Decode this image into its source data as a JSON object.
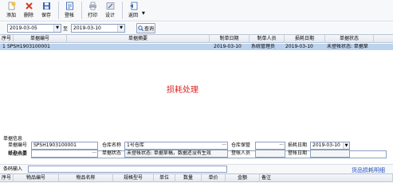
{
  "toolbar": {
    "buttons": [
      {
        "label": "添加",
        "icon": "add-doc-icon",
        "color": "#f2c53d"
      },
      {
        "label": "删除",
        "icon": "delete-x-icon",
        "color": "#d23c2c"
      },
      {
        "label": "保存",
        "icon": "save-disk-icon",
        "color": "#3b66b5"
      },
      {
        "label": "登帐",
        "icon": "post-account-icon",
        "color": "#3b66b5"
      },
      {
        "label": "打印",
        "icon": "printer-icon",
        "color": "#7a8494"
      },
      {
        "label": "设计",
        "icon": "design-icon",
        "color": "#7a8494"
      },
      {
        "label": "返回",
        "icon": "return-icon",
        "color": "#3b66b5"
      }
    ]
  },
  "filter": {
    "date_from": "2019-03-05",
    "to_label": "至",
    "date_to": "2019-03-10",
    "query_label": "查询"
  },
  "grid": {
    "columns": [
      "序号",
      "单据编号",
      "单据摘要",
      "制单日期",
      "制单人员",
      "损耗日期",
      "单据状态"
    ],
    "rows": [
      {
        "no": "1",
        "code": "SPSH1903100001",
        "summary": "",
        "make_date": "2019-03-10",
        "maker": "系统管理员",
        "loss_date": "2019-03-10",
        "status": "未登帐状态: 单据草"
      }
    ],
    "watermark": "损耗处理"
  },
  "detail": {
    "title": "单据信息",
    "doc_code_label": "单据编号",
    "doc_code": "SPSH1903100001",
    "warehouse_label": "仓库名称",
    "warehouse": "1号仓库",
    "keeper_label": "仓库保管",
    "keeper": "",
    "loss_date_label": "损耗日期",
    "loss_date": "2019-03-10",
    "summary_label": "单据摘要",
    "summary": "",
    "handler_label": "经办人员",
    "handler": "",
    "status_label": "单据状态",
    "status": "未登帐状态: 单据草稿，数据还没有生效",
    "post_person_label": "登帐人员",
    "post_person": "",
    "post_date_label": "登帐日期",
    "post_date": ""
  },
  "barcode": {
    "label": "条码输入",
    "value": "",
    "detail_title": "货品损耗明细"
  },
  "detail_grid": {
    "columns": [
      "序号",
      "物品编号",
      "物品名称",
      "规格型号",
      "单位",
      "数量",
      "单价",
      "金额",
      "备注"
    ]
  }
}
